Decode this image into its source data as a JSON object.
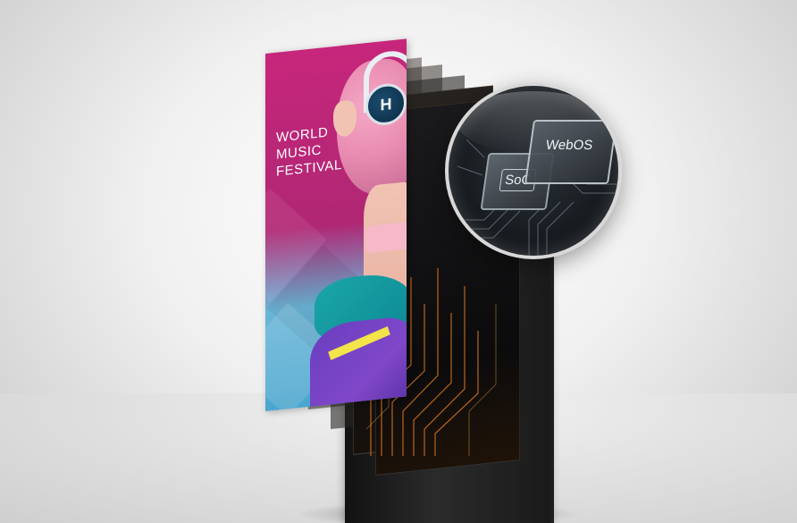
{
  "poster": {
    "title_lines": [
      "WORLD",
      "MUSIC",
      "FESTIVAL"
    ],
    "headphone_letter": "H"
  },
  "chips": {
    "soc_label": "SoC",
    "webos_label": "WebOS"
  },
  "icons": [
    "headphones-icon",
    "chip-icon"
  ],
  "colors": {
    "poster_magenta": "#c6267b",
    "poster_blue": "#4aa6cf",
    "hair_pink": "#e88bb0",
    "kiosk_black": "#1a1a1a",
    "circuit_orange": "#d8741c"
  }
}
